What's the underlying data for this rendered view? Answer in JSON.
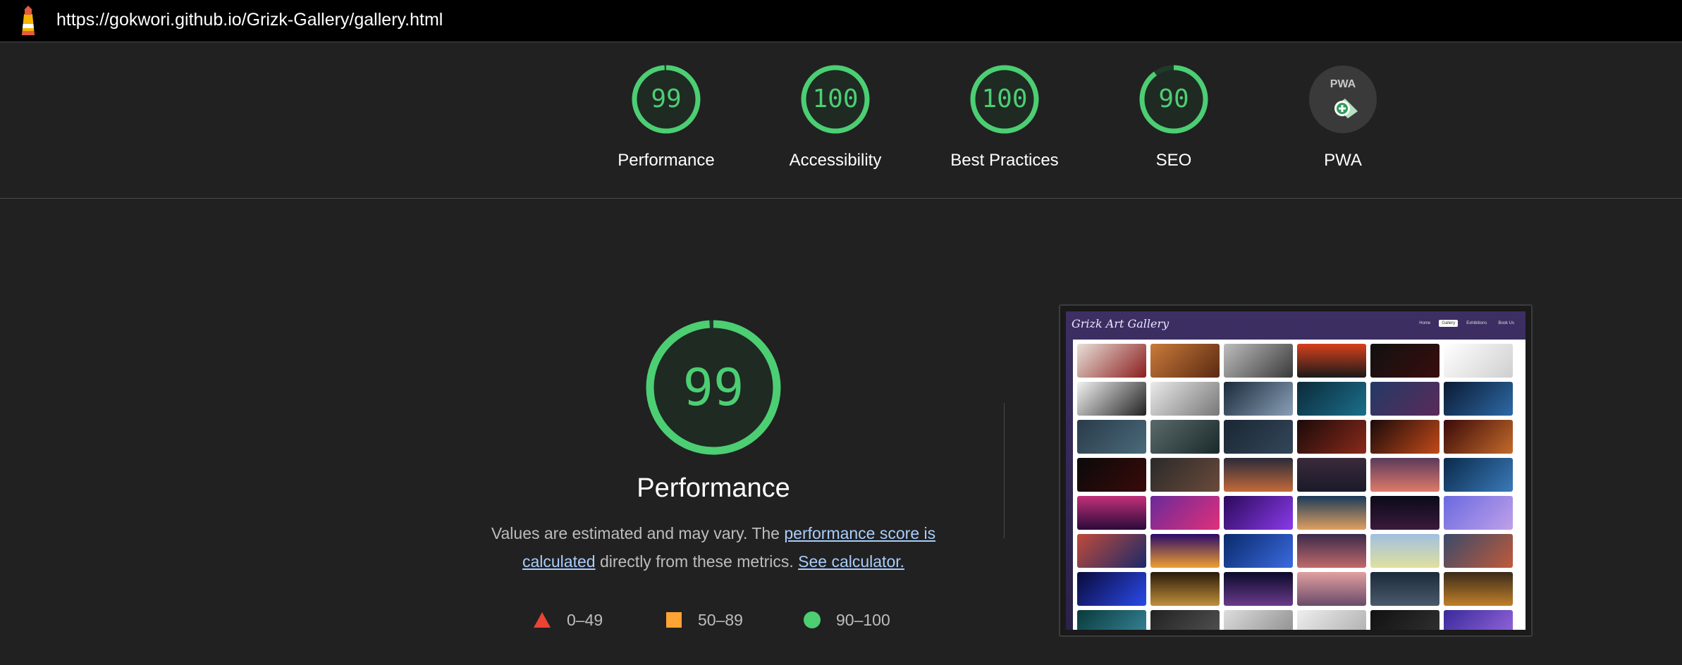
{
  "browser": {
    "url": "https://gokwori.github.io/Grizk-Gallery/gallery.html"
  },
  "gauges": [
    {
      "score": "99",
      "label": "Performance",
      "fraction": 0.99
    },
    {
      "score": "100",
      "label": "Accessibility",
      "fraction": 1.0
    },
    {
      "score": "100",
      "label": "Best Practices",
      "fraction": 1.0
    },
    {
      "score": "90",
      "label": "SEO",
      "fraction": 0.9
    },
    {
      "score": "",
      "label": "PWA",
      "badge_text": "PWA"
    }
  ],
  "performance": {
    "score": "99",
    "fraction": 0.99,
    "title": "Performance",
    "desc_prefix": "Values are estimated and may vary. The ",
    "link_score": "performance score is calculated",
    "desc_middle": " directly from these metrics. ",
    "link_calc": "See calculator."
  },
  "legend": [
    {
      "range": "0–49",
      "shape": "triangle",
      "color": "#eb4335"
    },
    {
      "range": "50–89",
      "shape": "square",
      "color": "#ffa335"
    },
    {
      "range": "90–100",
      "shape": "circle",
      "color": "#4cce73"
    }
  ],
  "screenshot": {
    "site_title": "Grizk Art Gallery",
    "nav": [
      "Home",
      "Gallery",
      "Exhibitions",
      "Book Us"
    ]
  },
  "colors": {
    "pass": "#4cce73",
    "pass_track": "#1e3a28",
    "background": "#212121"
  }
}
